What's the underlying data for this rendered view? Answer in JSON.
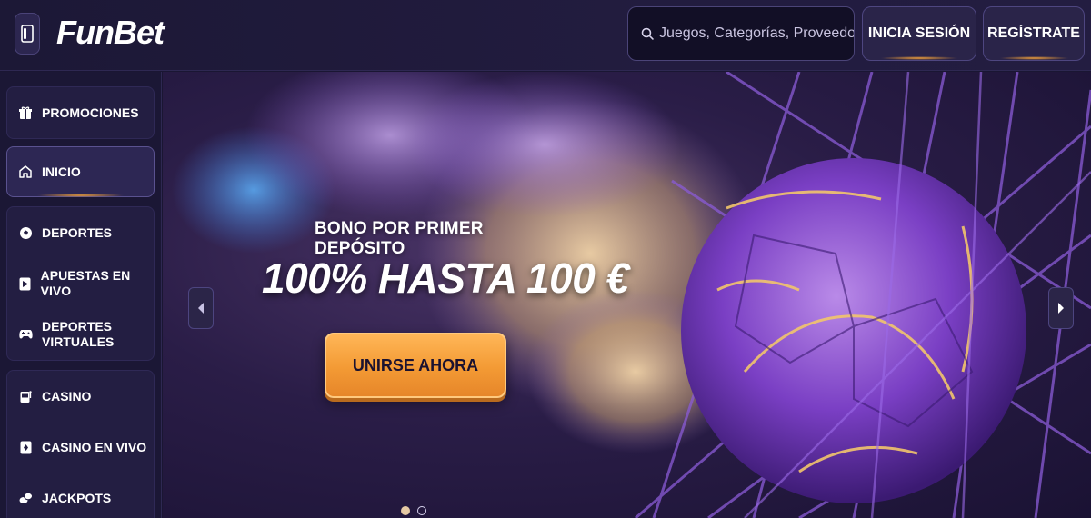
{
  "header": {
    "logo_text": "FunBet",
    "search_placeholder": "Juegos, Categorías, Proveedores",
    "login_label": "INICIA SESIÓN",
    "register_label": "REGÍSTRATE"
  },
  "sidebar": {
    "items": [
      {
        "label": "PROMOCIONES",
        "icon": "gift-icon"
      },
      {
        "label": "INICIO",
        "icon": "home-icon",
        "active": true
      },
      {
        "label": "DEPORTES",
        "icon": "soccer-ball-icon"
      },
      {
        "label": "APUESTAS EN VIVO",
        "icon": "live-play-icon"
      },
      {
        "label": "DEPORTES VIRTUALES",
        "icon": "gamepad-icon"
      },
      {
        "label": "CASINO",
        "icon": "slot-machine-icon"
      },
      {
        "label": "CASINO EN VIVO",
        "icon": "live-cards-icon"
      },
      {
        "label": "JACKPOTS",
        "icon": "coins-icon"
      }
    ]
  },
  "hero": {
    "kicker": "BONO POR PRIMER DEPÓSITO",
    "headline": "100% HASTA 100 €",
    "cta_label": "UNIRSE AHORA",
    "slides_total": 2,
    "active_slide": 1
  },
  "colors": {
    "accent_orange": "#f39a34",
    "background": "#1a1633",
    "panel": "#231e42"
  }
}
